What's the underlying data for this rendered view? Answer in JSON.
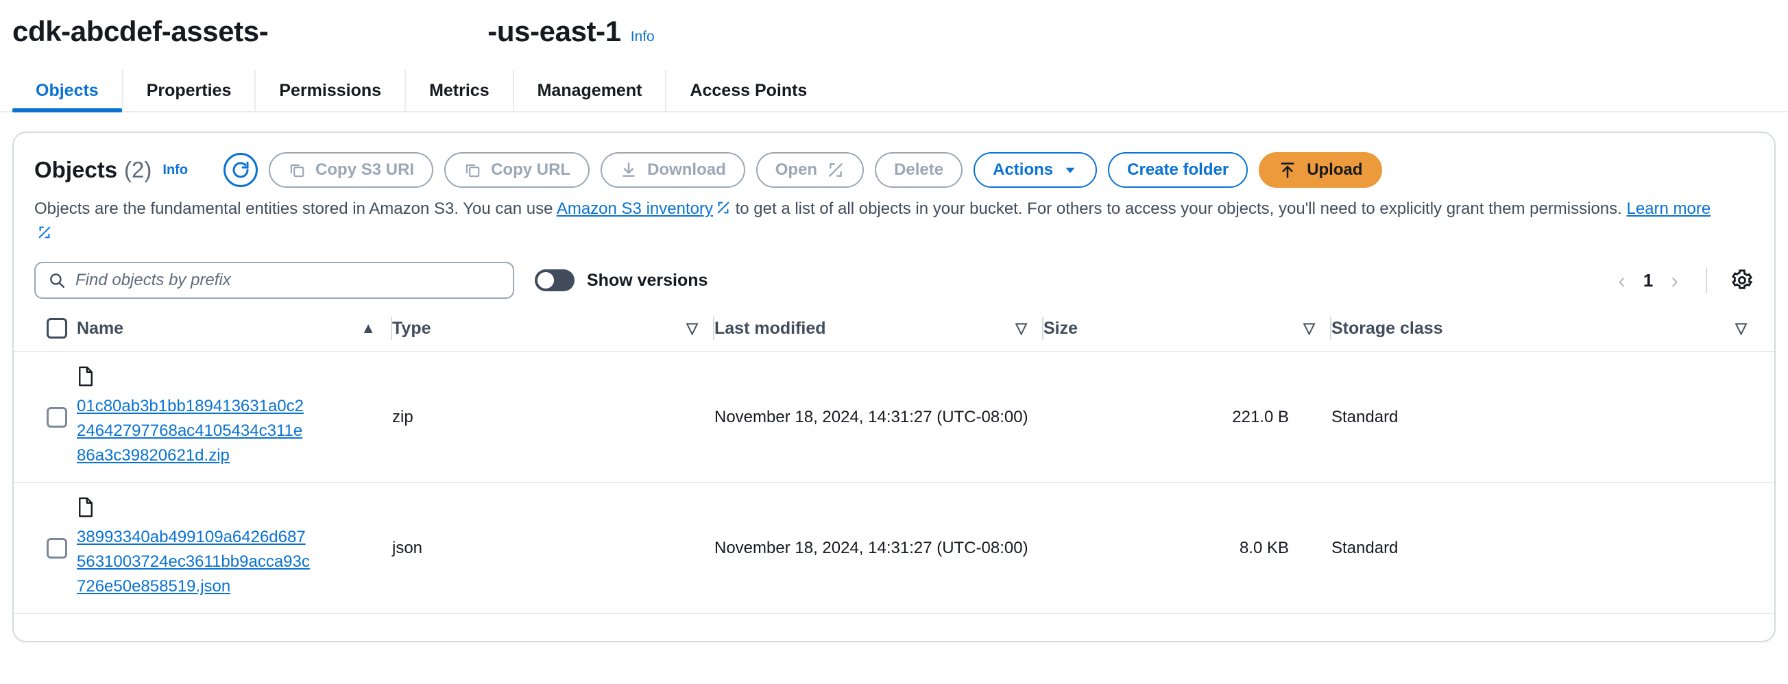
{
  "header": {
    "bucket_name_prefix": "cdk-abcdef-assets-",
    "bucket_name_suffix": "-us-east-1",
    "info_label": "Info"
  },
  "tabs": [
    {
      "label": "Objects",
      "active": true
    },
    {
      "label": "Properties",
      "active": false
    },
    {
      "label": "Permissions",
      "active": false
    },
    {
      "label": "Metrics",
      "active": false
    },
    {
      "label": "Management",
      "active": false
    },
    {
      "label": "Access Points",
      "active": false
    }
  ],
  "panel": {
    "title": "Objects",
    "count": "(2)",
    "info_label": "Info",
    "refresh_icon": "refresh-icon",
    "description_part1": "Objects are the fundamental entities stored in Amazon S3. You can use ",
    "description_link1": "Amazon S3 inventory",
    "description_part2": " to get a list of all objects in your bucket. For others to access your objects, you'll need to explicitly grant them permissions. ",
    "description_link2": "Learn more",
    "buttons": [
      {
        "label": "Copy S3 URI",
        "icon": "copy-icon",
        "style": "disabled"
      },
      {
        "label": "Copy URL",
        "icon": "copy-icon",
        "style": "disabled"
      },
      {
        "label": "Download",
        "icon": "download-icon",
        "style": "disabled"
      },
      {
        "label": "Open",
        "icon": "external-link-icon",
        "style": "disabled"
      },
      {
        "label": "Delete",
        "icon": "none",
        "style": "disabled"
      },
      {
        "label": "Actions",
        "icon": "chevron-down-icon",
        "style": "primary-outline"
      },
      {
        "label": "Create folder",
        "icon": "none",
        "style": "primary-outline"
      },
      {
        "label": "Upload",
        "icon": "upload-icon",
        "style": "filled"
      }
    ]
  },
  "filters": {
    "search_placeholder": "Find objects by prefix",
    "search_value": "",
    "search_icon": "search-icon",
    "toggle_label": "Show versions",
    "toggle_on": false,
    "page_number": "1",
    "prev_icon": "chevron-left-icon",
    "next_icon": "chevron-right-icon",
    "settings_icon": "gear-icon"
  },
  "table": {
    "columns": [
      {
        "label": "Name",
        "sort": "ascending",
        "sort_icon": "▲"
      },
      {
        "label": "Type",
        "sort": "none",
        "sort_icon": "▽"
      },
      {
        "label": "Last modified",
        "sort": "none",
        "sort_icon": "▽"
      },
      {
        "label": "Size",
        "sort": "none",
        "sort_icon": "▽"
      },
      {
        "label": "Storage class",
        "sort": "none",
        "sort_icon": "▽"
      }
    ],
    "rows": [
      {
        "name": "01c80ab3b1bb189413631a0c224642797768ac4105434c311e86a3c39820621d.zip",
        "type": "zip",
        "last_modified": "November 18, 2024, 14:31:27 (UTC-08:00)",
        "size": "221.0 B",
        "storage_class": "Standard",
        "selected": false,
        "icon": "file-icon"
      },
      {
        "name": "38993340ab499109a6426d6875631003724ec3611bb9acca93c726e50e858519.json",
        "type": "json",
        "last_modified": "November 18, 2024, 14:31:27 (UTC-08:00)",
        "size": "8.0 KB",
        "storage_class": "Standard",
        "selected": false,
        "icon": "file-icon"
      }
    ]
  },
  "colors": {
    "link": "#0972d3",
    "accent_orange": "#ec9a3c",
    "text": "#16191f",
    "muted": "#5f6b7a",
    "border": "#d5dbdb"
  }
}
